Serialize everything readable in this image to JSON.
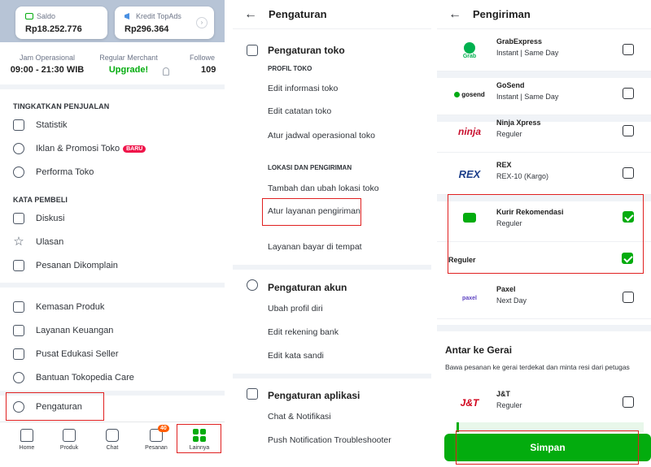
{
  "panel1": {
    "saldo_label": "Saldo",
    "saldo_value": "Rp18.252.776",
    "kredit_label": "Kredit TopAds",
    "kredit_value": "Rp296.364",
    "stats": [
      {
        "label": "Jam Operasional",
        "value": "09:00 - 21:30 WIB"
      },
      {
        "label": "Regular Merchant",
        "value": "Upgrade!"
      },
      {
        "label": "Followe",
        "value": "109"
      }
    ],
    "section_penjualan": "TINGKATKAN PENJUALAN",
    "penjualan_items": [
      "Statistik",
      "Iklan & Promosi Toko",
      "Performa Toko"
    ],
    "baru_badge": "BARU",
    "section_pembeli": "KATA PEMBELI",
    "pembeli_items": [
      "Diskusi",
      "Ulasan",
      "Pesanan Dikomplain"
    ],
    "other_items": [
      "Kemasan Produk",
      "Layanan Keuangan",
      "Pusat Edukasi Seller",
      "Bantuan Tokopedia Care"
    ],
    "pengaturan_label": "Pengaturan",
    "nav": [
      {
        "label": "Home",
        "icon": "home-icon"
      },
      {
        "label": "Produk",
        "icon": "product-icon"
      },
      {
        "label": "Chat",
        "icon": "chat-icon"
      },
      {
        "label": "Pesanan",
        "icon": "order-icon",
        "badge": "40"
      },
      {
        "label": "Lainnya",
        "icon": "grid-icon"
      }
    ]
  },
  "panel2": {
    "title": "Pengaturan",
    "toko_title": "Pengaturan toko",
    "profil_head": "PROFIL TOKO",
    "profil_items": [
      "Edit informasi toko",
      "Edit catatan toko",
      "Atur jadwal operasional toko"
    ],
    "lokasi_head": "LOKASI DAN PENGIRIMAN",
    "lokasi_items": [
      "Tambah dan ubah lokasi toko",
      "Atur layanan pengiriman"
    ],
    "bayar_item": "Layanan bayar di tempat",
    "akun_title": "Pengaturan akun",
    "akun_items": [
      "Ubah profil diri",
      "Edit rekening bank",
      "Edit kata sandi"
    ],
    "aplikasi_title": "Pengaturan aplikasi",
    "aplikasi_items": [
      "Chat & Notifikasi",
      "Push Notification Troubleshooter"
    ]
  },
  "panel3": {
    "title": "Pengiriman",
    "couriers": [
      {
        "logo": "Grab",
        "name": "GrabExpress",
        "service": "Instant | Same Day",
        "checked": false
      },
      {
        "logo": "gosend",
        "name": "GoSend",
        "service": "Instant | Same Day",
        "checked": false
      },
      {
        "logo": "ninja",
        "name": "Ninja Xpress",
        "service": "Reguler",
        "checked": false
      },
      {
        "logo": "REX",
        "name": "REX",
        "service": "REX-10 (Kargo)",
        "checked": false
      },
      {
        "logo": "",
        "name": "Kurir Rekomendasi",
        "service": "Reguler",
        "checked": true
      }
    ],
    "reguler_row": "Reguler",
    "paxel": {
      "logo": "paxel",
      "name": "Paxel",
      "service": "Next Day"
    },
    "antar_title": "Antar ke Gerai",
    "antar_desc": "Bawa pesanan ke gerai terdekat dan minta resi dari petugas",
    "jnt": {
      "logo": "J&T",
      "name": "J&T",
      "service": "Reguler"
    },
    "simpan": "Simpan"
  },
  "colors": {
    "accent": "#03ac0e",
    "highlight_box": "#e02020",
    "badge": "#ef144a"
  }
}
